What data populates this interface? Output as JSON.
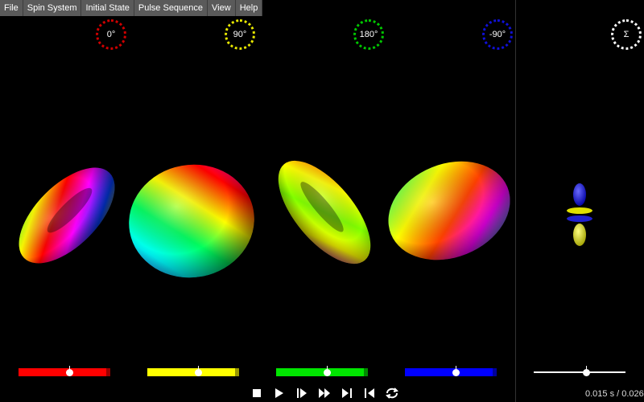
{
  "menu": {
    "items": [
      "File",
      "Spin System",
      "Initial State",
      "Pulse Sequence",
      "View",
      "Help"
    ]
  },
  "phases": [
    {
      "label": "0°",
      "color": "#d00000"
    },
    {
      "label": "90°",
      "color": "#e8e800"
    },
    {
      "label": "180°",
      "color": "#00c800"
    },
    {
      "label": "-90°",
      "color": "#1010d8"
    },
    {
      "label": "Σ",
      "color": "#ffffff"
    }
  ],
  "sliders": [
    {
      "color": "#ff0000",
      "end_color": "#9a0000",
      "value": 0.55
    },
    {
      "color": "#ffff00",
      "end_color": "#9a9a00",
      "value": 0.55
    },
    {
      "color": "#00e600",
      "end_color": "#008a00",
      "value": 0.55
    },
    {
      "color": "#0000ff",
      "end_color": "#000099",
      "value": 0.55
    },
    {
      "color": "#ffffff",
      "end_color": "#ffffff",
      "value": 0.57
    }
  ],
  "playback": {
    "buttons": [
      "stop-icon",
      "play-icon",
      "step-forward-icon",
      "fast-forward-icon",
      "skip-end-icon",
      "skip-start-icon",
      "loop-icon"
    ],
    "time_text": "0.015 s / 0.026 s"
  }
}
